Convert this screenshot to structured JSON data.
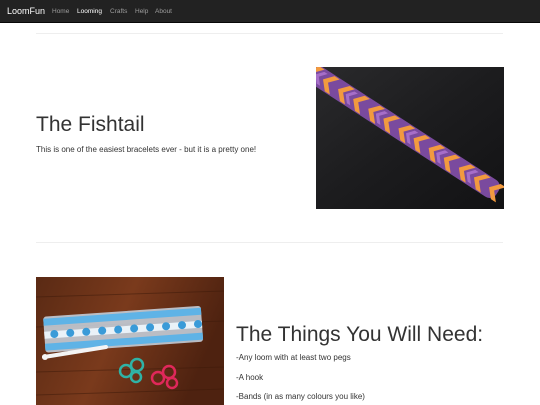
{
  "navbar": {
    "brand": "LoomFun",
    "links": [
      "Home",
      "Looming",
      "Crafts",
      "Help",
      "About"
    ],
    "active_index": 1,
    "colors": {
      "background": "#222222",
      "link": "#9d9d9d",
      "active": "#ffffff"
    }
  },
  "feature1": {
    "heading": "The Fishtail",
    "text": "This is one of the easiest bracelets ever - but it is a pretty one!"
  },
  "feature2": {
    "heading": "The Things You Will Need:",
    "items": [
      "-Any loom with at least two pegs",
      "-A hook",
      "-Bands (in as many colours you like)"
    ]
  }
}
